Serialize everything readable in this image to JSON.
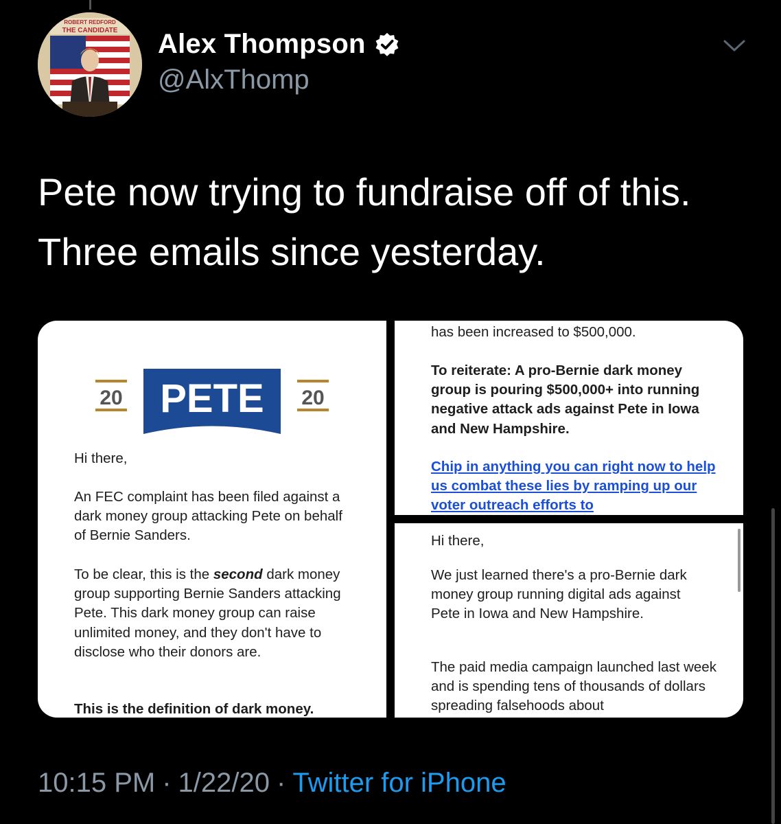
{
  "author": {
    "display_name": "Alex Thompson",
    "handle": "@AlxThomp",
    "verified": true,
    "avatar_text": "THE CANDIDATE",
    "avatar_icon": "campaign-poster-avatar"
  },
  "tweet": {
    "text": "Pete now trying to fundraise off of this. Three emails since yesterday."
  },
  "media": {
    "email1": {
      "logo": {
        "left": "20",
        "center": "PETE",
        "right": "20",
        "color": "#1c4a94",
        "accent": "#b7862c"
      },
      "greeting": "Hi there,",
      "p1": "An FEC complaint has been filed against a dark money group attacking Pete on behalf of Bernie Sanders.",
      "p2_pre": "To be clear, this is the",
      "p2_em": "second",
      "p2_post": "dark money group supporting Bernie Sanders attacking Pete. This dark money group can raise unlimited money, and they don't have to disclose who their donors are.",
      "p3": "This is the definition of dark money."
    },
    "email2": {
      "top": "has been increased to $500,000.",
      "bold": "To reiterate: A pro-Bernie dark money group is pouring $500,000+ into running negative attack ads against Pete in Iowa and New Hampshire.",
      "link": "Chip in anything you can right now to help us combat these lies by ramping up our voter outreach efforts to"
    },
    "email3": {
      "greeting": "Hi there,",
      "p1": "We just learned there's a pro-Bernie dark money group running digital ads against Pete in Iowa and New Hampshire.",
      "p2": "The paid media campaign launched last week and is spending tens of thousands of dollars spreading falsehoods about"
    }
  },
  "meta": {
    "time": "10:15 PM",
    "date": "1/22/20",
    "separator": "·",
    "source": "Twitter for iPhone"
  },
  "colors": {
    "background": "#000000",
    "secondary": "#8b98a5",
    "link": "#1d9bf0"
  }
}
